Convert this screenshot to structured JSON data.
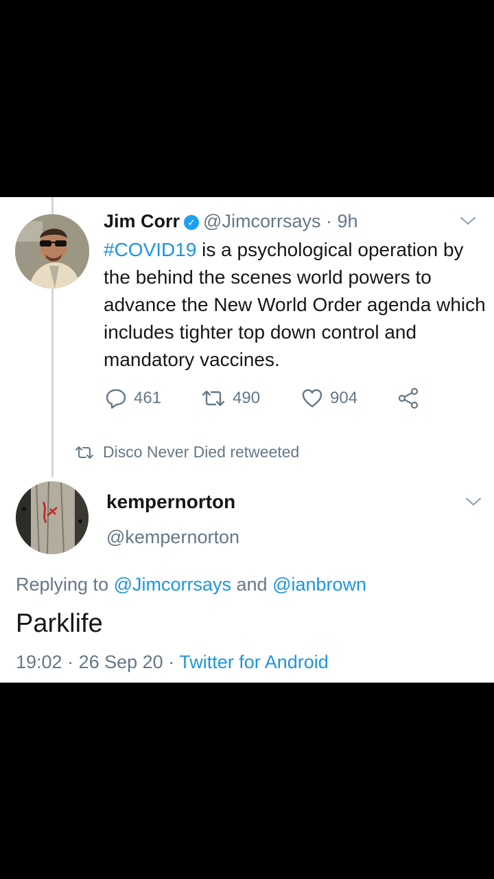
{
  "tweet1": {
    "name": "Jim Corr",
    "handle": "@Jimcorrsays",
    "separator": "·",
    "time": "9h",
    "hashtag": "#COVID19",
    "text": " is a psychological operation by the behind the scenes world powers to advance the New World Order agenda which includes tighter top down control and mandatory vaccines.",
    "replies": "461",
    "retweets": "490",
    "likes": "904"
  },
  "retweet_notice": "Disco Never Died retweeted",
  "tweet2": {
    "name": "kempernorton",
    "handle": "@kempernorton",
    "replying_prefix": "Replying to ",
    "reply_to_1": "@Jimcorrsays",
    "reply_and": " and ",
    "reply_to_2": "@ianbrown",
    "text": "Parklife",
    "time": "19:02",
    "dot1": " · ",
    "date": "26 Sep 20",
    "dot2": " · ",
    "source": "Twitter for Android"
  },
  "colors": {
    "link": "#1b95e0",
    "muted": "#657786",
    "verified": "#1da1f2"
  },
  "icons": [
    "verified-icon",
    "chevron-down-icon",
    "reply-icon",
    "retweet-icon",
    "like-icon",
    "share-icon"
  ]
}
